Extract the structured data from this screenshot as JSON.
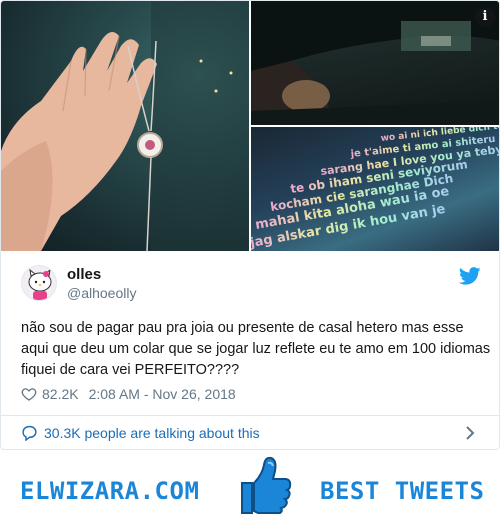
{
  "tweet": {
    "user": {
      "name": "olles",
      "handle": "@alhoeolly"
    },
    "text": "não sou de pagar pau pra joia ou presente de casal hetero mas esse aqui que deu um colar que se jogar luz reflete eu te amo em 100 idiomas fiquei de cara vei PERFEITO????",
    "likes": "82.2K",
    "timestamp": "2:08 AM - Nov 26, 2018",
    "talking": "30.3K people are talking about this",
    "info_label": "i"
  },
  "media": {
    "projection_lines": [
      "wo ai ni  ich liebe dich  te amo",
      "je t'aime  ti amo  ai shiteru",
      "sarang hae  I love you  ya tebya",
      "te ob iham  seni seviyorum",
      "kocham cie  saranghae  Dich",
      "mahal kita  aloha wau ia oe",
      "jag alskar dig  ik hou van je"
    ]
  },
  "footer": {
    "left_brand": "ELWIZARA.COM",
    "right_brand": "BEST TWEETS"
  },
  "colors": {
    "brand_blue": "#1b86d8",
    "twitter_blue": "#1da1f2",
    "link_blue": "#1b6db5",
    "muted": "#657786"
  },
  "icons": [
    "info-icon",
    "twitter-bird-icon",
    "heart-icon",
    "speech-bubble-icon",
    "chevron-right-icon",
    "thumbs-up-icon",
    "hello-kitty-avatar"
  ]
}
